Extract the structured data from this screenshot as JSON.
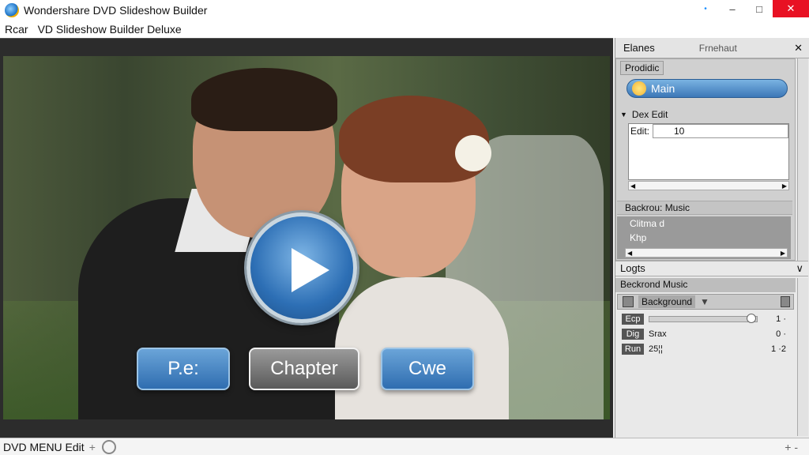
{
  "window": {
    "title": "Wondershare DVD Slideshow Builder",
    "controls": {
      "help": "•",
      "minimize": "–",
      "maximize": "□",
      "close": "✕"
    }
  },
  "menubar": {
    "item": "Rcar",
    "subtitle": "VD Slideshow Builder Deluxe"
  },
  "preview": {
    "buttons": [
      {
        "label": "P.e:"
      },
      {
        "label": "Chapter"
      },
      {
        "label": "Cwe"
      }
    ]
  },
  "status": {
    "label": "DVD MENU Edit",
    "plus": "+",
    "right": "+ -"
  },
  "panel": {
    "header": {
      "title": "Elanes",
      "subtitle": "Frnehaut",
      "close": "✕"
    },
    "tab": "Prodidic",
    "main_button": "Main",
    "dex_edit": {
      "label": "Dex Edit",
      "edit_label": "Edit:",
      "edit_value": "10"
    },
    "music_header": "Backrou: Music",
    "list": [
      "Clitma d",
      "Khp"
    ],
    "logts": {
      "title": "Logts",
      "chevron": "∨"
    },
    "background_music": {
      "header": "Beckrond Music",
      "dropdown": "Background",
      "rows": [
        {
          "tag": "Ecp",
          "kind": "slider",
          "level": 0.95,
          "value": "1 ·"
        },
        {
          "tag": "Dig",
          "kind": "text",
          "text": "Srax",
          "value": "0 ·"
        },
        {
          "tag": "Run",
          "kind": "text",
          "text": "25¦¦",
          "value": "1 ·2"
        }
      ]
    }
  }
}
